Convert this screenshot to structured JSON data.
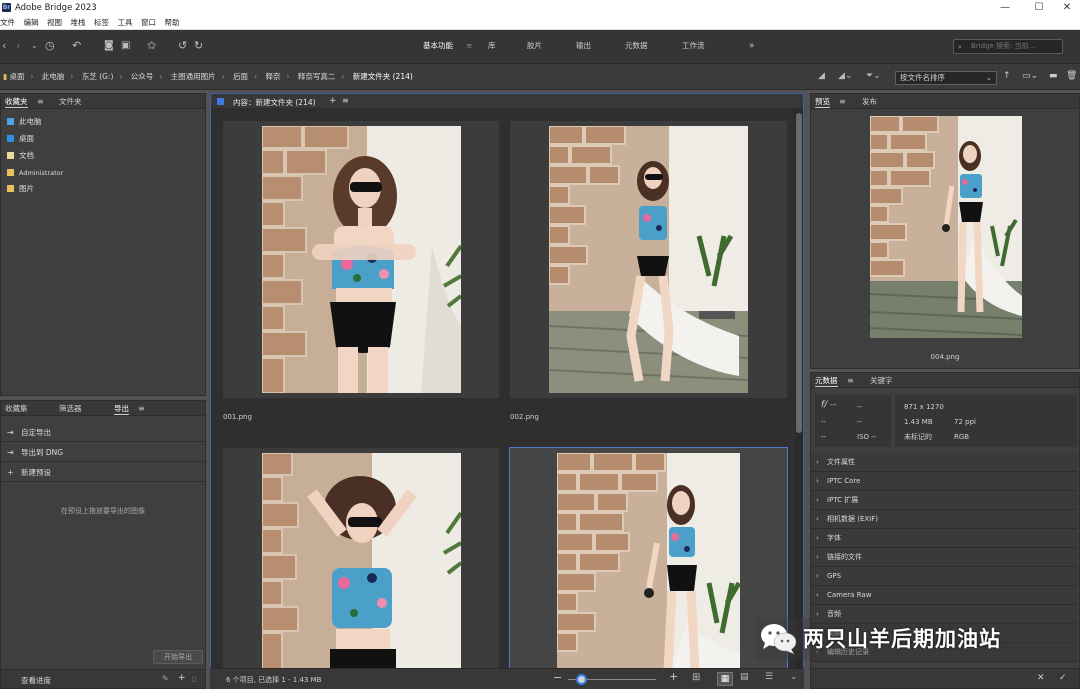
{
  "app": {
    "title": "Adobe Bridge 2023",
    "logo_text": "Br"
  },
  "menu": [
    "文件",
    "编辑",
    "视图",
    "堆栈",
    "标签",
    "工具",
    "窗口",
    "帮助"
  ],
  "workspaces": {
    "items": [
      "基本功能",
      "库",
      "胶片",
      "输出",
      "元数据",
      "工作流"
    ],
    "more": "»"
  },
  "search": {
    "placeholder": "Bridge 搜索: 当前..."
  },
  "breadcrumbs": [
    "桌面",
    "此电脑",
    "东芝 (G:)",
    "公众号",
    "主图通用图片",
    "后面",
    "释奈",
    "释奈写真二",
    "新建文件夹 (214)"
  ],
  "sort": {
    "label": "按文件名排序"
  },
  "favorites_panel": {
    "tabs": [
      "收藏夹",
      "文件夹"
    ],
    "items": [
      "此电脑",
      "桌面",
      "文档",
      "Administrator",
      "图片"
    ]
  },
  "export_panel": {
    "tabs": [
      "收藏集",
      "筛选器",
      "导出"
    ],
    "rows": [
      "自定导出",
      "导出到 DNG",
      "新建预设"
    ],
    "hint": "在预设上拖放要导出的图像",
    "start_button": "开始导出",
    "footer_label": "查看进度"
  },
  "content": {
    "header": "内容：新建文件夹 (214)",
    "items": [
      {
        "name": "001.png"
      },
      {
        "name": "002.png"
      },
      {
        "name": ""
      },
      {
        "name": ""
      }
    ],
    "status": "6 个项目, 已选择 1 - 1.43 MB",
    "thumb_size_level": 0.15
  },
  "preview_panel": {
    "tabs": [
      "预览",
      "发布"
    ],
    "filename": "004.png"
  },
  "metadata_panel": {
    "tabs": [
      "元数据",
      "关键字"
    ],
    "camera": {
      "fstop": "f/ --",
      "shutter": "--",
      "c1": "--",
      "c2": "--",
      "c3": "--",
      "iso": "ISO --"
    },
    "file": {
      "dims": "871 x 1270",
      "size": "1.43 MB",
      "ppi": "72 ppi",
      "label": "未标记的",
      "mode": "RGB"
    },
    "sections": [
      "文件属性",
      "IPTC Core",
      "IPTC 扩展",
      "相机数据 (EXIF)",
      "字体",
      "链接的文件",
      "GPS",
      "Camera Raw",
      "音频",
      "视频",
      "编辑历史记录"
    ]
  },
  "watermark": {
    "text": "两只山羊后期加油站"
  }
}
